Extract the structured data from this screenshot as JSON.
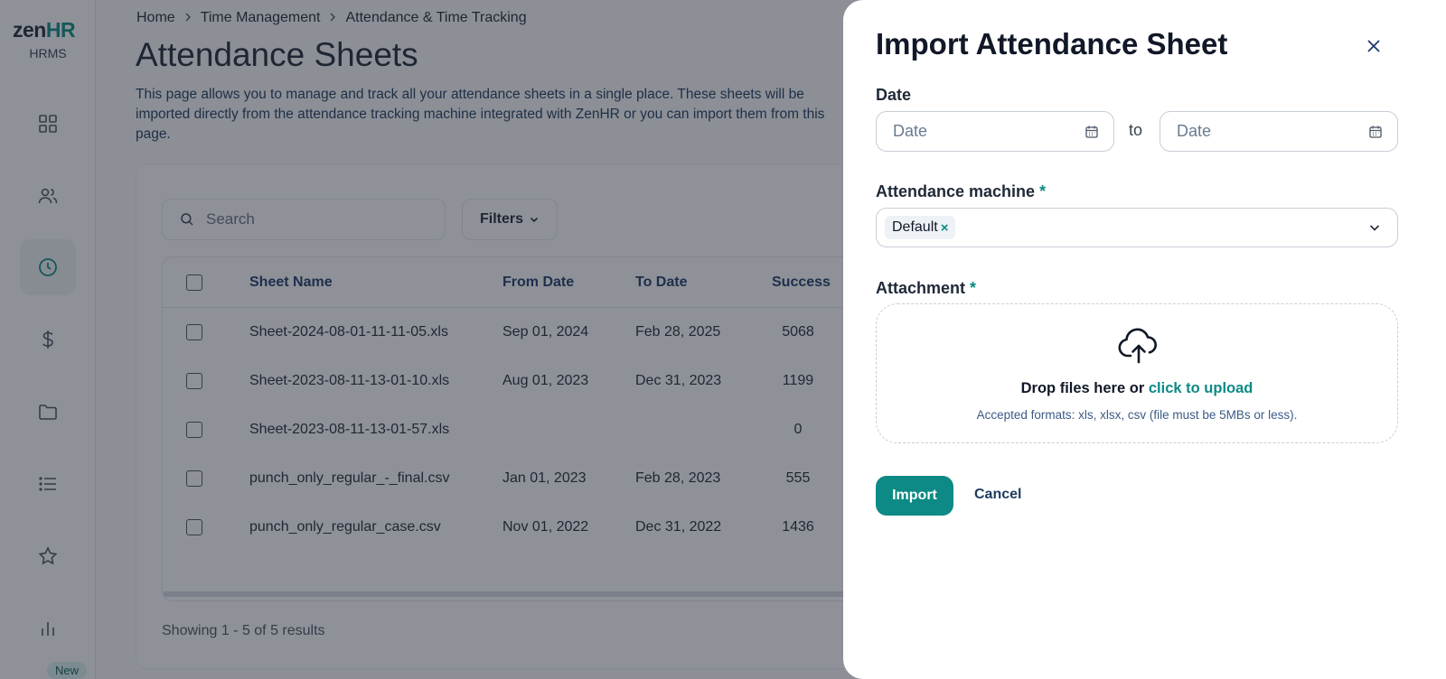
{
  "sidebar": {
    "logo_main": "zen",
    "logo_accent": "HR",
    "logo_sub": "HRMS",
    "items": [
      {
        "name": "dashboard-icon"
      },
      {
        "name": "people-icon"
      },
      {
        "name": "clock-icon",
        "active": true
      },
      {
        "name": "dollar-icon"
      },
      {
        "name": "folder-icon"
      },
      {
        "name": "list-icon"
      },
      {
        "name": "star-icon"
      },
      {
        "name": "bar-chart-icon"
      }
    ],
    "new_badge": "New"
  },
  "breadcrumb": {
    "home": "Home",
    "section": "Time Management",
    "current": "Attendance & Time Tracking"
  },
  "page": {
    "title": "Attendance Sheets",
    "description": "This page allows you to manage and track all your attendance sheets in a single place. These sheets will be imported directly from the attendance tracking machine integrated with ZenHR or you can import them from this page."
  },
  "toolbar": {
    "search_placeholder": "Search",
    "filters_label": "Filters"
  },
  "table": {
    "columns": [
      "Sheet Name",
      "From Date",
      "To Date",
      "Success"
    ],
    "rows": [
      {
        "name": "Sheet-2024-08-01-11-11-05.xls",
        "from": "Sep 01, 2024",
        "to": "Feb 28, 2025",
        "success": "5068"
      },
      {
        "name": "Sheet-2023-08-11-13-01-10.xls",
        "from": "Aug 01, 2023",
        "to": "Dec 31, 2023",
        "success": "1199"
      },
      {
        "name": "Sheet-2023-08-11-13-01-57.xls",
        "from": "",
        "to": "",
        "success": "0"
      },
      {
        "name": "punch_only_regular_-_final.csv",
        "from": "Jan 01, 2023",
        "to": "Feb 28, 2023",
        "success": "555"
      },
      {
        "name": "punch_only_regular_case.csv",
        "from": "Nov 01, 2022",
        "to": "Dec 31, 2022",
        "success": "1436"
      }
    ]
  },
  "pagination": {
    "showing": "Showing 1 - 5 of 5 results"
  },
  "drawer": {
    "title": "Import Attendance Sheet",
    "date_label": "Date",
    "from_placeholder": "Date",
    "to_label": "to",
    "to_placeholder": "Date",
    "machine_label": "Attendance machine",
    "required_mark": "*",
    "machine_chip": "Default",
    "chip_remove": "×",
    "attachment_label": "Attachment",
    "drop_text": "Drop files here or",
    "upload_link": "click to upload",
    "formats_hint": "Accepted formats: xls, xlsx, csv (file must be 5MBs or less).",
    "import_label": "Import",
    "cancel_label": "Cancel"
  },
  "colors": {
    "brand": "#0d8a85",
    "overlay": "#1e2430"
  }
}
